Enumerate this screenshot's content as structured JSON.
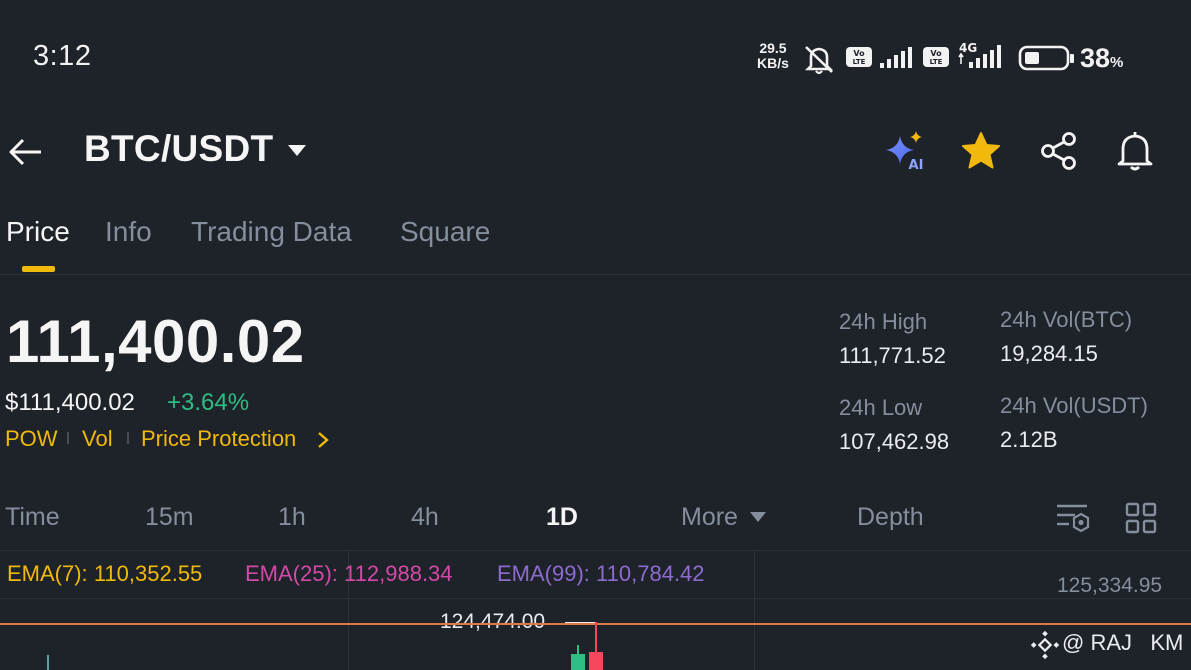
{
  "status_bar": {
    "time": "3:12",
    "net_speed_value": "29.5",
    "net_speed_unit": "KB/s",
    "volte1": "Vo LTE",
    "volte2": "Vo LTE",
    "network": "4G",
    "battery_percent": "38",
    "battery_unit": "%",
    "battery_level": 0.38
  },
  "header": {
    "pair": "BTC/USDT",
    "icons": [
      "back-arrow-icon",
      "ai-sparkle-icon",
      "star-icon",
      "share-icon",
      "bell-icon"
    ],
    "ai_badge": "AI",
    "favorite_color": "#f0b90b"
  },
  "tabs": [
    {
      "label": "Price",
      "active": true
    },
    {
      "label": "Info"
    },
    {
      "label": "Trading Data"
    },
    {
      "label": "Square"
    }
  ],
  "ticker": {
    "last_price": "111,400.02",
    "usd_price": "$111,400.02",
    "change_pct": "+3.64%",
    "tags": [
      "POW",
      "Vol",
      "Price Protection"
    ],
    "high_label": "24h High",
    "high_value": "111,771.52",
    "low_label": "24h Low",
    "low_value": "107,462.98",
    "vol_btc_label": "24h Vol(BTC)",
    "vol_btc_value": "19,284.15",
    "vol_usdt_label": "24h Vol(USDT)",
    "vol_usdt_value": "2.12B"
  },
  "intervals": {
    "items": [
      "Time",
      "15m",
      "1h",
      "4h",
      "1D",
      "More",
      "Depth"
    ],
    "active": "1D"
  },
  "chart": {
    "ema7": {
      "label": "EMA(7):",
      "value": "110,352.55",
      "color": "#f0b90b"
    },
    "ema25": {
      "label": "EMA(25):",
      "value": "112,988.34",
      "color": "#d349a7"
    },
    "ema99": {
      "label": "EMA(99):",
      "value": "110,784.42",
      "color": "#8e6bd1"
    },
    "axis_top": "125,334.95",
    "high_marker": "124,474.00",
    "watermark": "@ RAJ   KM"
  }
}
